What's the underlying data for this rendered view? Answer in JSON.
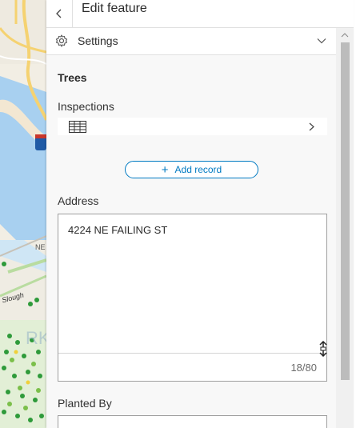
{
  "header": {
    "title": "Edit feature",
    "back_icon": "chevron-left-icon"
  },
  "settings": {
    "label": "Settings",
    "icon": "gear-icon",
    "expand_icon": "chevron-down-icon"
  },
  "form": {
    "section_title": "Trees",
    "inspections": {
      "label": "Inspections",
      "icon": "table-icon",
      "open_icon": "chevron-right-icon"
    },
    "add_record_label": "Add record",
    "address": {
      "label": "Address",
      "value": "4224 NE FAILING ST",
      "counter": "18/80"
    },
    "planted_by": {
      "label": "Planted By",
      "value": ""
    }
  },
  "map": {
    "labels": [
      "NE",
      "Slough",
      "RK"
    ],
    "colors": {
      "water": "#a8d0f0",
      "road": "#f5d271",
      "park": "#b9dca0",
      "tree": "#2e9a3a"
    }
  },
  "colors": {
    "accent": "#007ac2",
    "panel_bg": "#f8f8f8",
    "border": "#e0e0e0"
  }
}
